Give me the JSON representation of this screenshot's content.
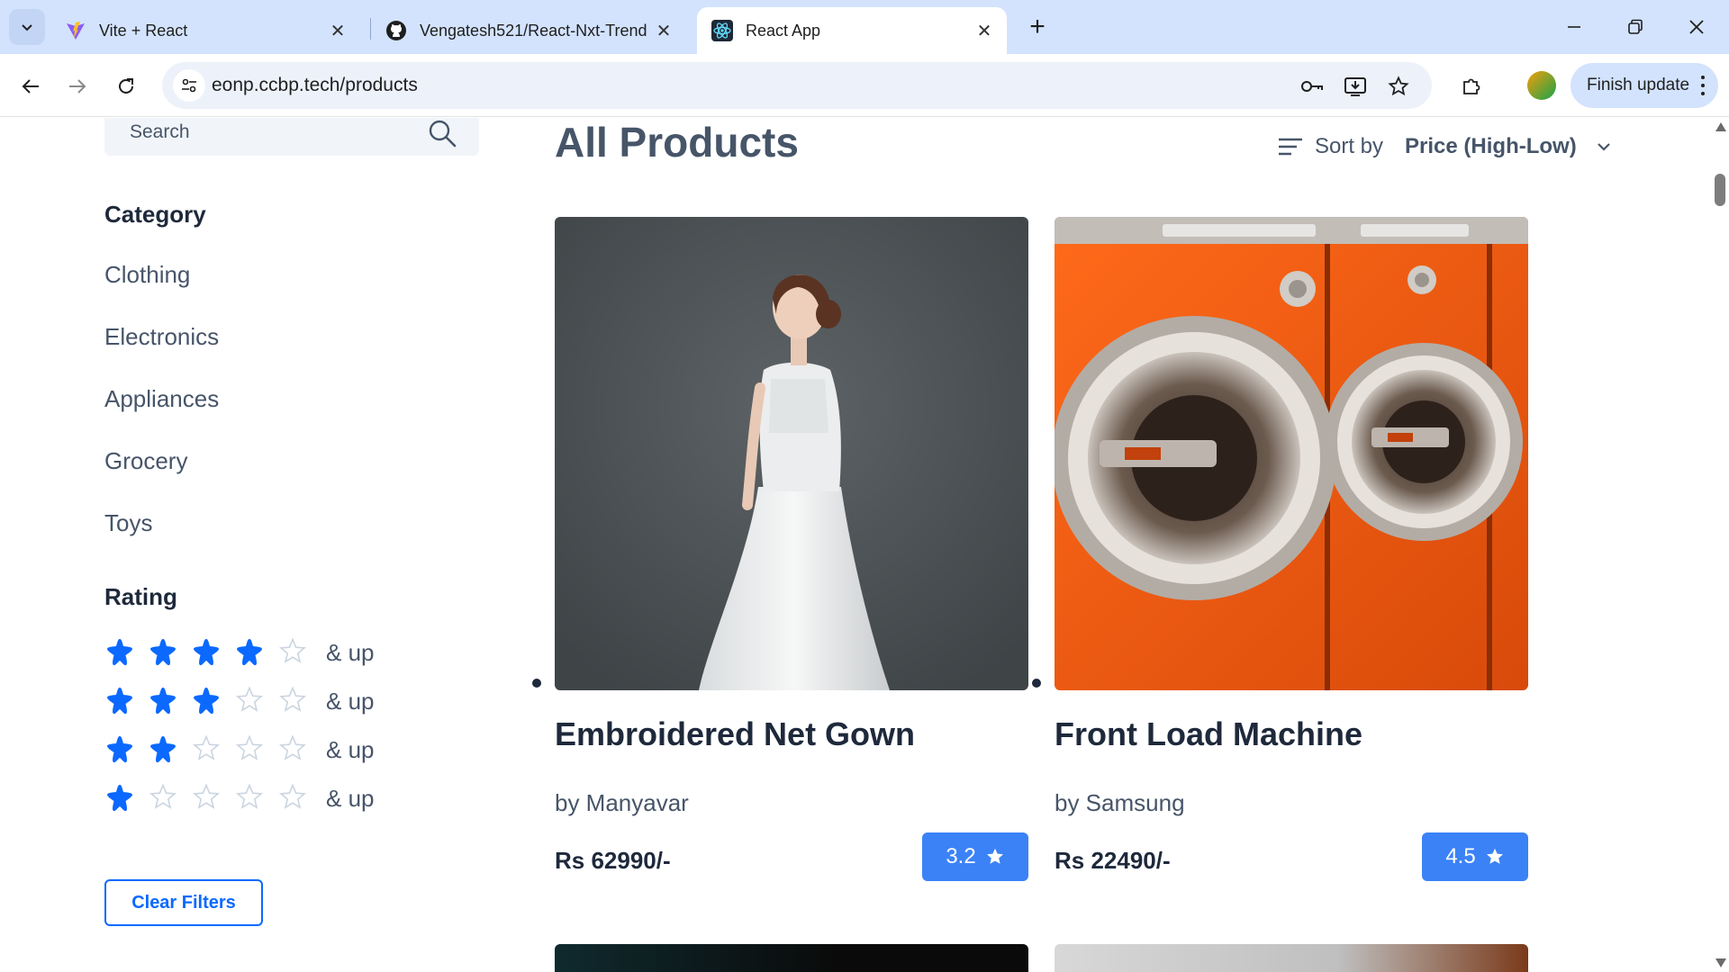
{
  "browser": {
    "tabs": [
      {
        "title": "Vite + React",
        "icon": "vite-icon",
        "active": false
      },
      {
        "title": "Vengatesh521/React-Nxt-Trend",
        "icon": "github-icon",
        "active": false
      },
      {
        "title": "React App",
        "icon": "react-icon",
        "active": true
      }
    ],
    "url": "eonp.ccbp.tech/products",
    "finish_update_label": "Finish update"
  },
  "sidebar": {
    "search_placeholder": "Search",
    "category_heading": "Category",
    "categories": [
      "Clothing",
      "Electronics",
      "Appliances",
      "Grocery",
      "Toys"
    ],
    "rating_heading": "Rating",
    "ratings": [
      {
        "stars": 4,
        "label": "& up"
      },
      {
        "stars": 3,
        "label": "& up"
      },
      {
        "stars": 2,
        "label": "& up"
      },
      {
        "stars": 1,
        "label": "& up"
      }
    ],
    "clear_filters_label": "Clear Filters"
  },
  "main": {
    "title": "All Products",
    "sort_label": "Sort by",
    "sort_value": "Price (High-Low)",
    "products": [
      {
        "name": "Embroidered Net Gown",
        "brand": "by Manyavar",
        "price": "Rs 62990/-",
        "rating": "3.2",
        "image": "bridal-gown-photo"
      },
      {
        "name": "Front Load Machine",
        "brand": "by Samsung",
        "price": "Rs 22490/-",
        "rating": "4.5",
        "image": "washing-machines-photo"
      }
    ]
  },
  "colors": {
    "accent": "#0b69ff",
    "badge": "#3b82f6",
    "star_filled": "#0b69ff",
    "text_dark": "#1e293b",
    "text_muted": "#475569"
  }
}
